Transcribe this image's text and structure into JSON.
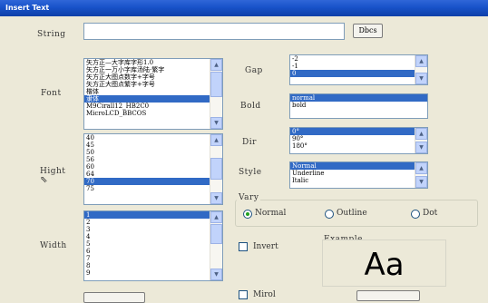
{
  "window": {
    "title": "Insert Text"
  },
  "string": {
    "label": "String",
    "value": "",
    "button_label": "Dbcs"
  },
  "font": {
    "label": "Font",
    "items": [
      "矢方正—大字库字形1.0",
      "矢方正一万小字库汤陆·繁字",
      "矢方正大图点数字+字号",
      "矢方正大图点繁字+字号",
      "楷体",
      "隶体",
      "M9Cirall12_HB2C0",
      "MicroLCD_BBCOS"
    ],
    "selected_index": 5
  },
  "height": {
    "label": "Hight",
    "items": [
      "40",
      "45",
      "50",
      "56",
      "60",
      "64",
      "70",
      "75"
    ],
    "selected_index": 6
  },
  "width": {
    "label": "Width",
    "items": [
      "1",
      "2",
      "3",
      "4",
      "5",
      "6",
      "7",
      "8",
      "9"
    ],
    "selected_index": 0
  },
  "gap": {
    "label": "Gap",
    "items": [
      "-2",
      "-1",
      "0"
    ],
    "selected_index": 2
  },
  "bold": {
    "label": "Bold",
    "items": [
      "normal",
      "bold"
    ],
    "selected_index": 0
  },
  "dir": {
    "label": "Dir",
    "items": [
      "0°",
      "90°",
      "180°"
    ],
    "selected_index": 0
  },
  "style": {
    "label": "Style",
    "items": [
      "Normal",
      "Underline",
      "Italic"
    ],
    "selected_index": 0
  },
  "vary": {
    "label": "Vary",
    "options": [
      {
        "label": "Normal",
        "checked": true
      },
      {
        "label": "Outline",
        "checked": false
      },
      {
        "label": "Dot",
        "checked": false
      }
    ]
  },
  "invert": {
    "label": "Invert",
    "checked": false
  },
  "mirror": {
    "label": "Mirol",
    "checked": false
  },
  "example": {
    "label": "Example",
    "preview": "Aa"
  }
}
